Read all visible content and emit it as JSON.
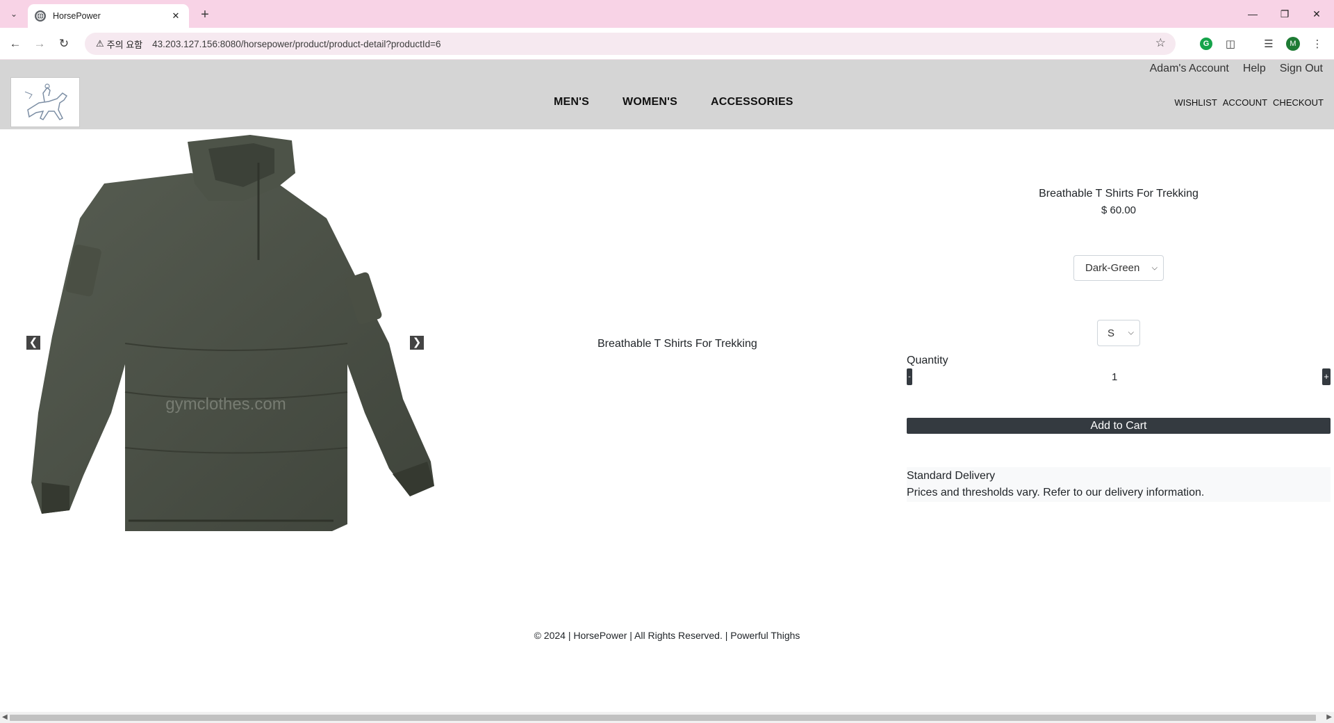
{
  "browser": {
    "tab_title": "HorsePower",
    "security_label": "주의 요함",
    "url": "43.203.127.156:8080/horsepower/product/product-detail?productId=6",
    "profile_initial": "M"
  },
  "header": {
    "top_links": [
      "Adam's Account",
      "Help",
      "Sign Out"
    ],
    "main_nav": [
      "MEN'S",
      "WOMEN'S",
      "ACCESSORIES"
    ],
    "util_nav": [
      "WISHLIST",
      "ACCOUNT",
      "CHECKOUT"
    ]
  },
  "product": {
    "name": "Breathable T Shirts For Trekking",
    "center_name": "Breathable T Shirts For Trekking",
    "price": "$ 60.00",
    "color_selected": "Dark-Green",
    "size_selected": "S",
    "quantity_label": "Quantity",
    "quantity": "1",
    "minus": "-",
    "plus": "+",
    "add_to_cart": "Add to Cart",
    "image_watermark": "gymclothes.com",
    "prev_arrow": "❮",
    "next_arrow": "❯"
  },
  "delivery": {
    "title": "Standard Delivery",
    "text": "Prices and thresholds vary. Refer to our delivery information."
  },
  "footer": {
    "text": "© 2024 | HorsePower | All Rights Reserved. | Powerful Thighs"
  },
  "colors": {
    "header_bg": "#d5d5d5",
    "tabbar_bg": "#f8d3e6",
    "button_dark": "#343a40",
    "shirt": "#4a5045"
  }
}
